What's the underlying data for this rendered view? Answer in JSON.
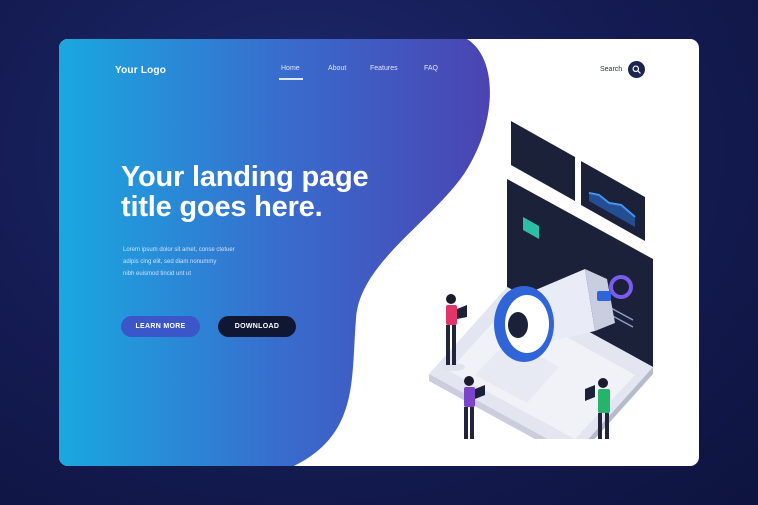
{
  "brand": {
    "logo_text": "Your Logo"
  },
  "nav": {
    "items": [
      {
        "label": "Home",
        "active": true
      },
      {
        "label": "About",
        "active": false
      },
      {
        "label": "Features",
        "active": false
      },
      {
        "label": "FAQ",
        "active": false
      }
    ],
    "search_label": "Search"
  },
  "hero": {
    "title_line1": "Your landing page",
    "title_line2": "title goes here.",
    "body_line1": "Lorem ipsum dolor sit amet, conse ctetuer",
    "body_line2": "adipis cing elit, sed diam nonummy",
    "body_line3": "nibh euismod tincid unt ut",
    "learn_more_label": "LEARN MORE",
    "download_label": "DOWNLOAD"
  },
  "colors": {
    "page_bg": "#141b52",
    "gradient_start": "#1aa8e0",
    "gradient_end": "#4a44b2",
    "learn_button": "#3a56c8",
    "download_button": "#101733"
  }
}
